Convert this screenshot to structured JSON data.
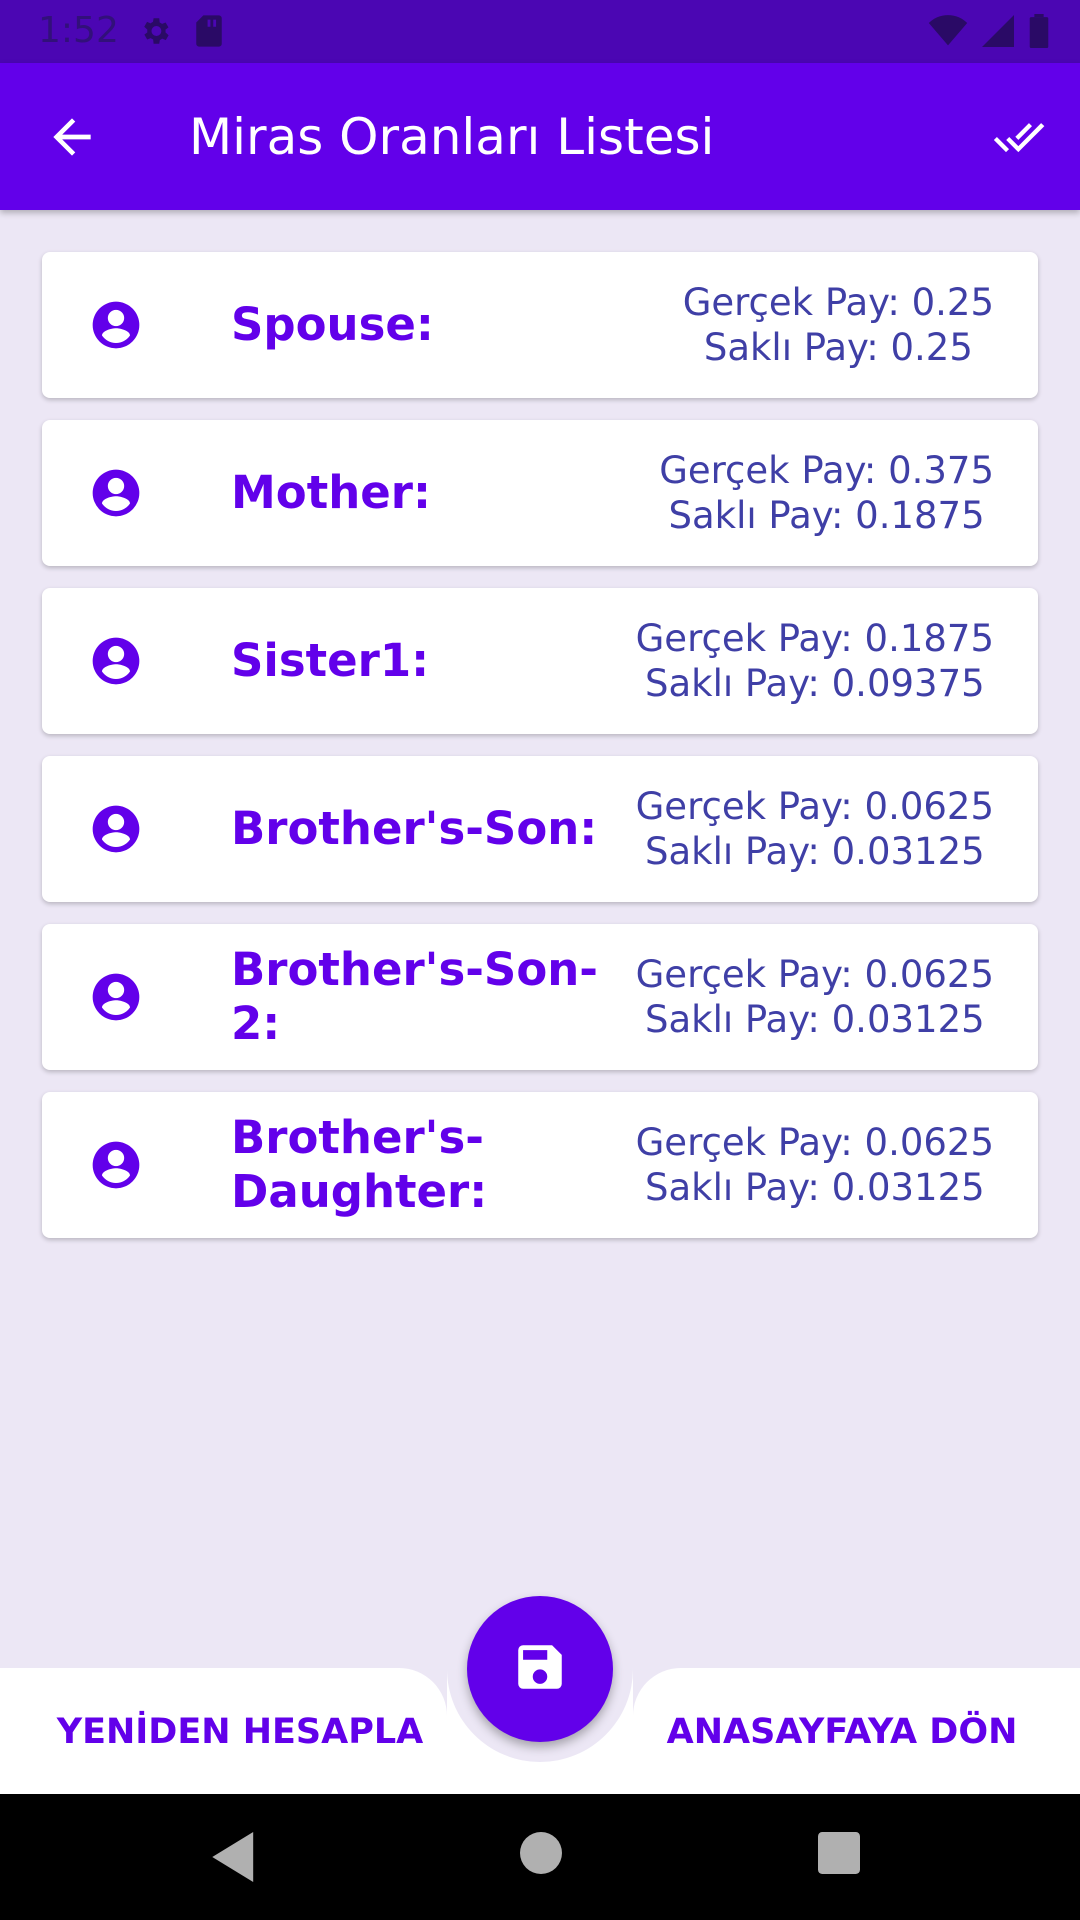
{
  "status_bar": {
    "time": "1:52"
  },
  "app_bar": {
    "title": "Miras Oranları Listesi"
  },
  "heirs": [
    {
      "name": "Spouse:",
      "gercek": "Gerçek Pay: 0.25",
      "sakli": "Saklı Pay: 0.25"
    },
    {
      "name": "Mother:",
      "gercek": "Gerçek Pay: 0.375",
      "sakli": "Saklı Pay: 0.1875"
    },
    {
      "name": "Sister1:",
      "gercek": "Gerçek Pay: 0.1875",
      "sakli": "Saklı Pay: 0.09375"
    },
    {
      "name": "Brother's-Son:",
      "gercek": "Gerçek Pay: 0.0625",
      "sakli": "Saklı Pay: 0.03125"
    },
    {
      "name": "Brother's-Son-2:",
      "gercek": "Gerçek Pay: 0.0625",
      "sakli": "Saklı Pay: 0.03125"
    },
    {
      "name": "Brother's-Daughter:",
      "gercek": "Gerçek Pay: 0.0625",
      "sakli": "Saklı Pay: 0.03125"
    }
  ],
  "bottom_bar": {
    "left_label": "YENİDEN HESAPLA",
    "right_label": "ANASAYFAYA DÖN"
  },
  "colors": {
    "primary": "#6200ea",
    "status_bar": "#4b06b3",
    "background": "#ece7f5",
    "share_text": "#3f3fa6"
  }
}
